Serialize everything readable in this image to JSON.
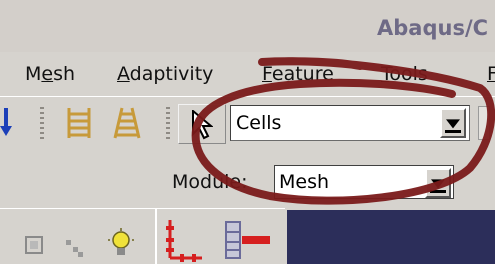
{
  "window": {
    "title": "Abaqus/C"
  },
  "menu": {
    "items": [
      {
        "pre": "M",
        "ul": "e",
        "post": "sh"
      },
      {
        "pre": "",
        "ul": "A",
        "post": "daptivity"
      },
      {
        "pre": "",
        "ul": "F",
        "post": "eature"
      },
      {
        "pre": "",
        "ul": "T",
        "post": "ools"
      },
      {
        "pre": "",
        "ul": "F",
        "post": ""
      }
    ]
  },
  "toolbar": {
    "selection_combo": {
      "value": "Cells"
    }
  },
  "module": {
    "label": "Module:",
    "value": "Mesh"
  },
  "annotation": {
    "color": "#7a1a1a"
  },
  "colors": {
    "viewport": "#2c2e5a",
    "accent_red": "#d61f1f",
    "icon_gold": "#c79a3a"
  }
}
